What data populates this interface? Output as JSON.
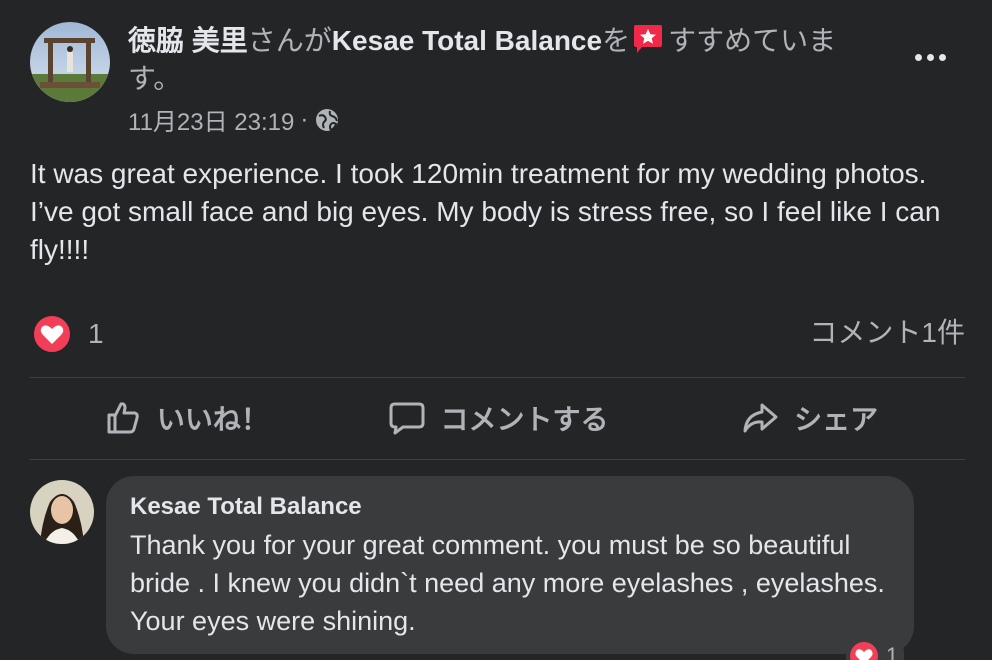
{
  "post": {
    "author": "徳脇 美里",
    "text_san_ga": "さんが",
    "page_name": "Kesae Total Balance",
    "text_wo": "を",
    "text_recommends": "すすめています。",
    "timestamp": "11月23日 23:19",
    "separator": "·",
    "privacy_icon": "globe-icon",
    "body": "It was great experience. I took 120min treatment for my wedding photos. I’ve got small face and big eyes. My body is stress free, so I feel like I can fly!!!!"
  },
  "stats": {
    "reaction_count": "1",
    "comment_count": "コメント1件"
  },
  "actions": {
    "like": "いいね！",
    "comment": "コメントする",
    "share": "シェア"
  },
  "comment": {
    "author": "Kesae Total Balance",
    "text": "Thank you for your great comment. you must be so beautiful bride . I knew you didn`t need any more eyelashes , eyelashes. Your eyes were shining.",
    "reaction_count": "1"
  },
  "colors": {
    "background": "#242526",
    "bubble": "#3a3b3c",
    "love": "#f33e58",
    "recommend": "#f02849"
  }
}
